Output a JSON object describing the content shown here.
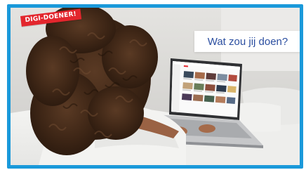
{
  "badge": {
    "label": "DIGI-DOENER!"
  },
  "question": {
    "text": "Wat zou jij doen?"
  },
  "colors": {
    "frame": "#1a99da",
    "badge": "#e3262d",
    "question_text": "#2b4ea0"
  },
  "icons": {
    "photo": "person-using-laptop-photo"
  }
}
